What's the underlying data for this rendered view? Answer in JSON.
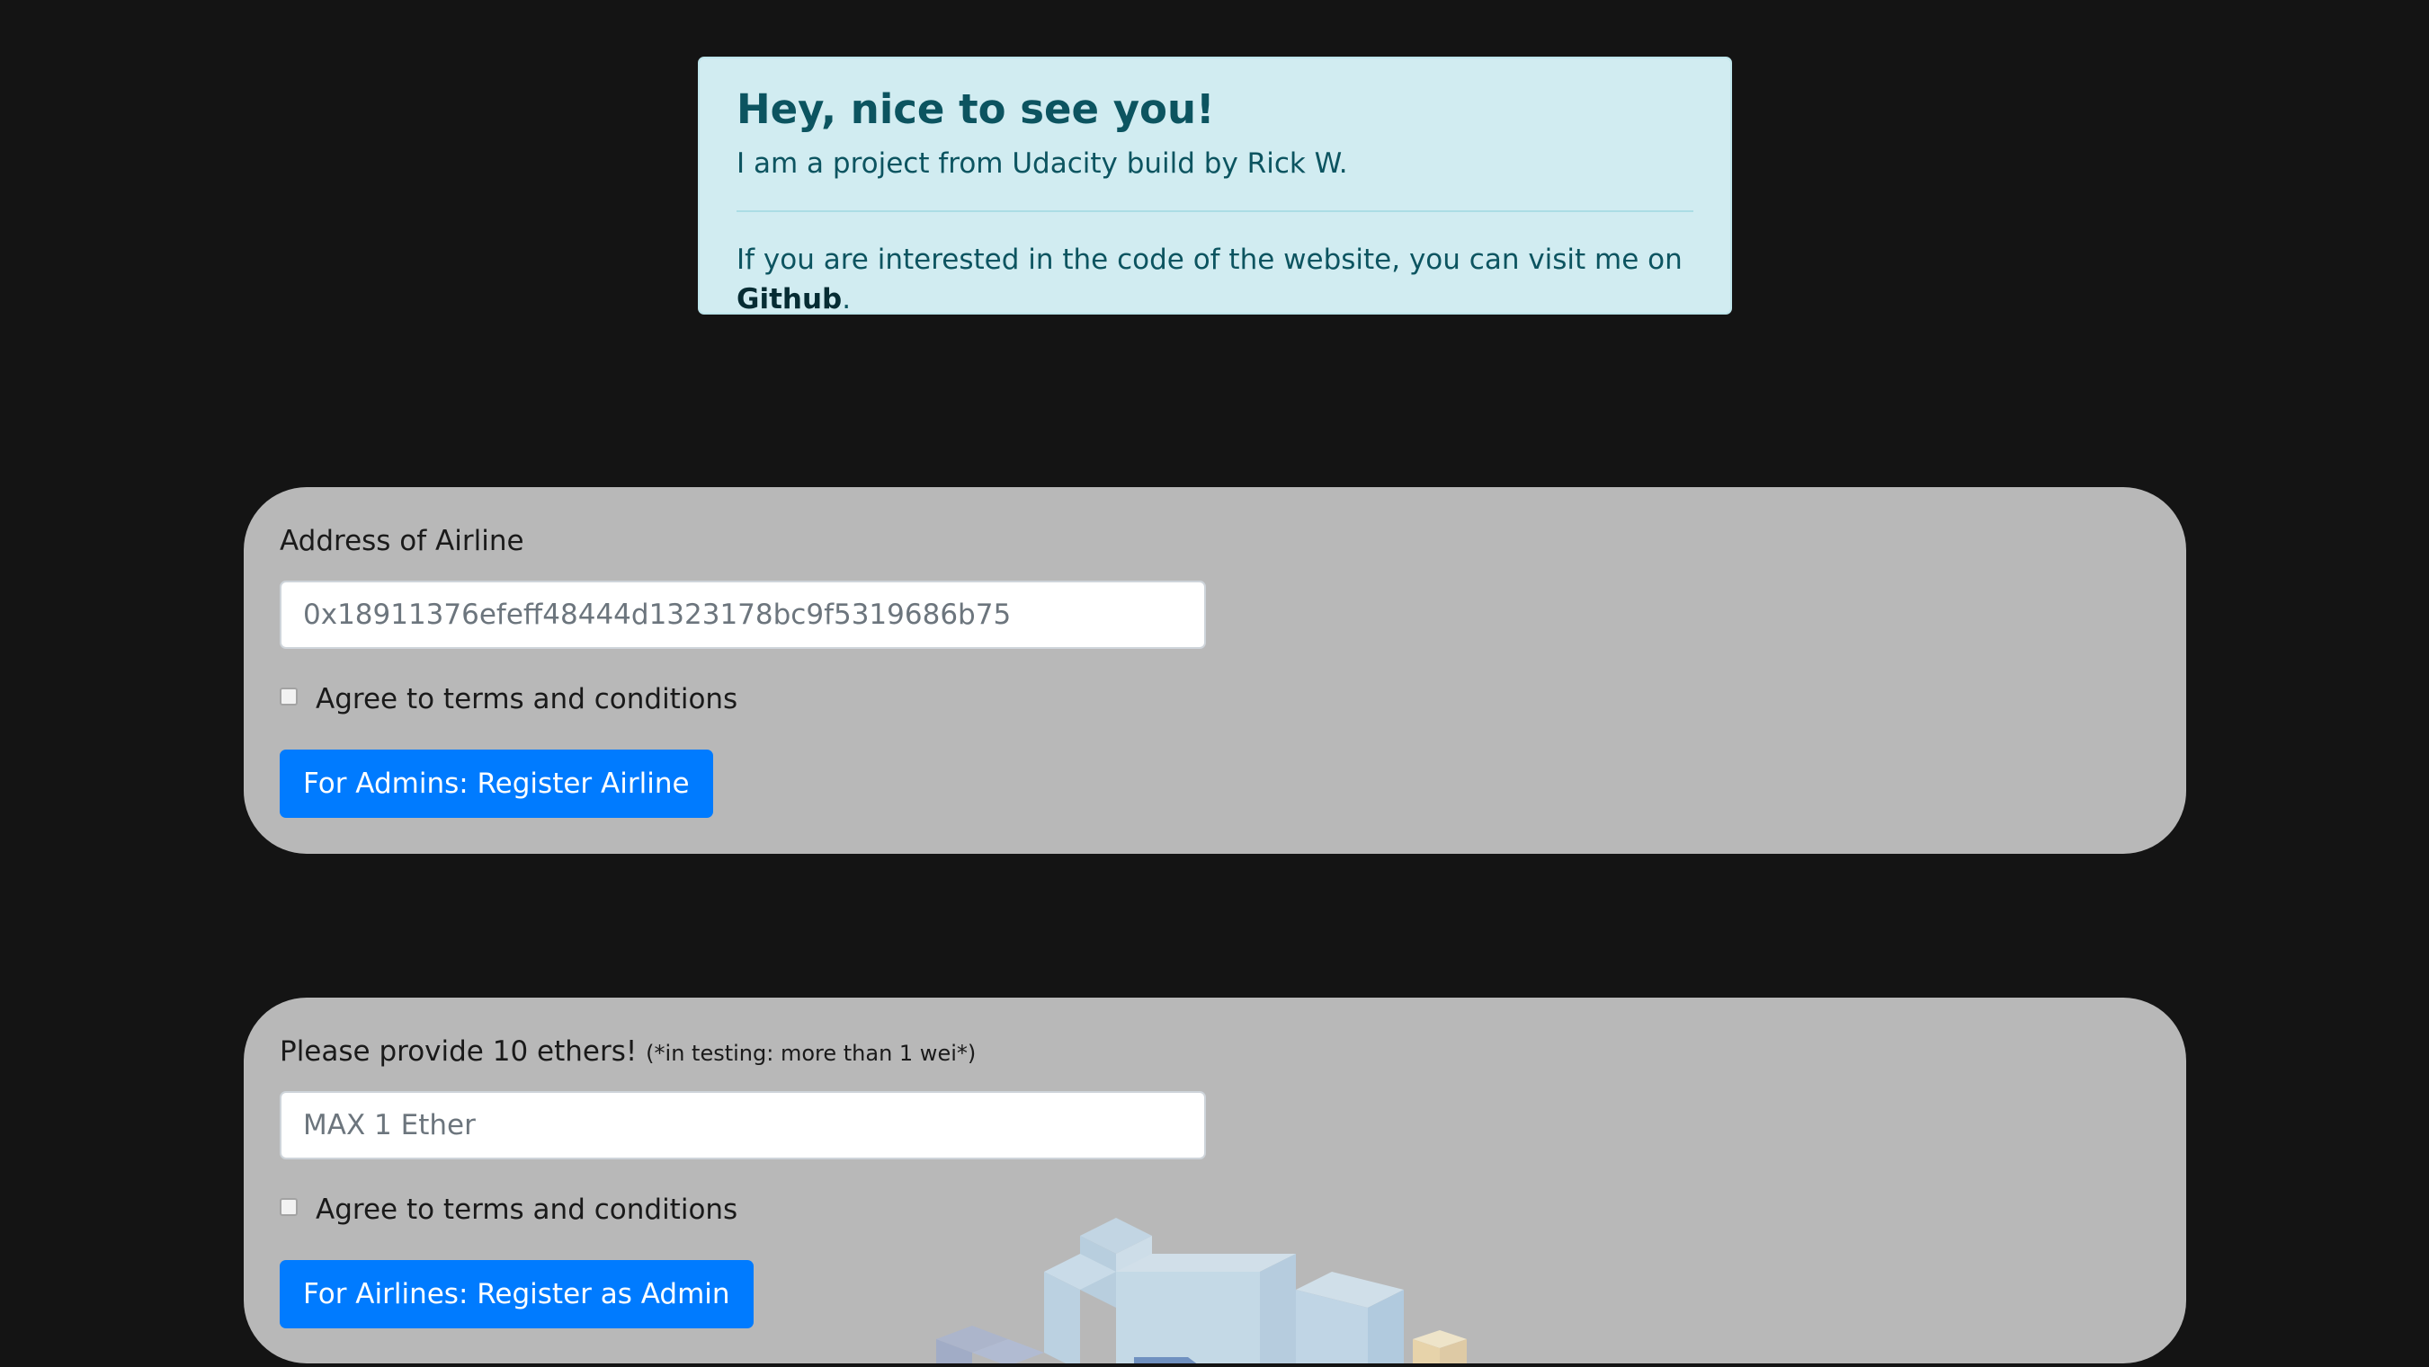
{
  "welcome": {
    "heading": "Hey, nice to see you!",
    "subtext": "I am a project from Udacity build by Rick W.",
    "bottom_text": "If you are interested in the code of the website, you can visit me on",
    "link_text": "Github",
    "period": "."
  },
  "register_airline": {
    "label": "Address of Airline",
    "input_value": "0x18911376efeff48444d1323178bc9f5319686b75",
    "checkbox_label": "Agree to terms and conditions",
    "button_label": "For Admins: Register Airline"
  },
  "register_admin": {
    "label": "Please provide 10 ethers!",
    "note": "(*in testing: more than 1 wei*)",
    "input_placeholder": "MAX 1 Ether",
    "checkbox_label": "Agree to terms and conditions",
    "button_label": "For Airlines: Register as Admin"
  },
  "colors": {
    "page_background": "#141414",
    "alert_background": "#d1ecf1",
    "alert_text": "#0c5460",
    "panel_background": "#b8b8b8",
    "primary_button": "#007bff"
  }
}
